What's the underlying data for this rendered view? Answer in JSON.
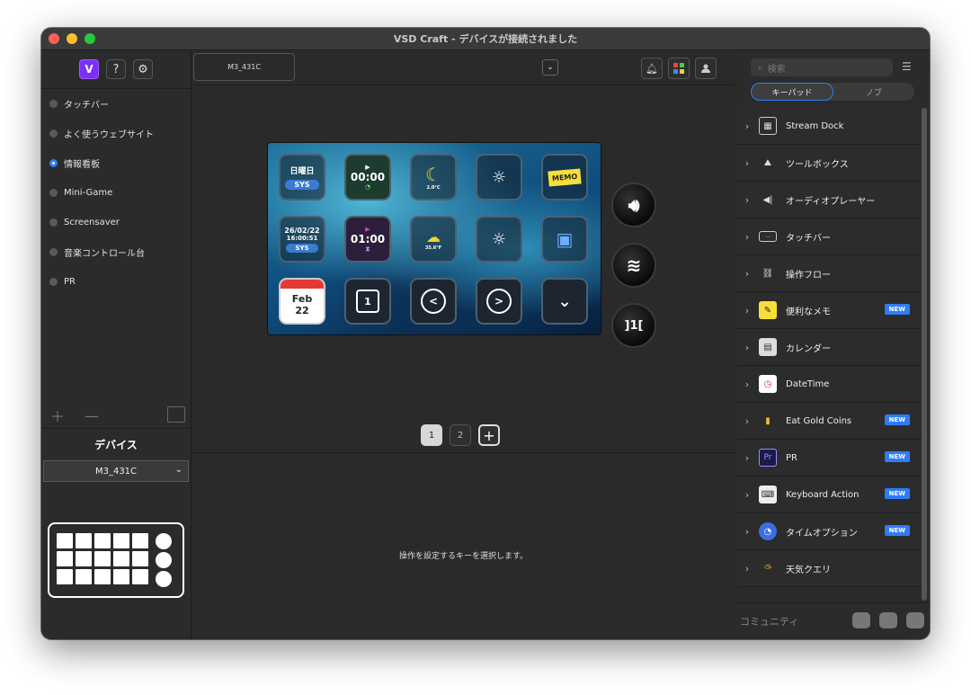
{
  "window": {
    "title": "VSD Craft - デバイスが接続されました"
  },
  "left": {
    "pages": [
      {
        "label": "タッチバー",
        "selected": false
      },
      {
        "label": "よく使うウェブサイト",
        "selected": false
      },
      {
        "label": "情報看板",
        "selected": true
      },
      {
        "label": "Mini-Game",
        "selected": false
      },
      {
        "label": "Screensaver",
        "selected": false
      },
      {
        "label": "音楽コントロール台",
        "selected": false
      },
      {
        "label": "PR",
        "selected": false
      }
    ],
    "device_title": "デバイス",
    "device_select": "M3_431C"
  },
  "center": {
    "device_tab": "M3_431C",
    "keys": {
      "k1_line1": "日曜日",
      "k1_line2": "SYS",
      "k2_line1": "00:00",
      "k3_line1": "2.0°C",
      "k5_line1": "MEMO",
      "k6_line1": "26/02/22",
      "k6_line2": "16:00:51",
      "k6_line3": "SYS",
      "k7_line1": "01:00",
      "k8_line1": "35.6°F",
      "k11_line1": "Feb",
      "k11_line2": "22",
      "k12_line1": "1",
      "k13_line1": "<",
      "k14_line1": ">"
    },
    "pages": [
      "1",
      "2"
    ],
    "hint": "操作を設定するキーを選択します。"
  },
  "right": {
    "search_placeholder": "検索",
    "tabs": [
      "キーパッド",
      "ノブ"
    ],
    "plugins": [
      {
        "label": "Stream Dock",
        "new": false,
        "icon": "grid-icon"
      },
      {
        "label": "ツールボックス",
        "new": false,
        "icon": "toolbox-icon"
      },
      {
        "label": "オーディオプレーヤー",
        "new": false,
        "icon": "audio-icon"
      },
      {
        "label": "タッチバー",
        "new": false,
        "icon": "keyboard-icon"
      },
      {
        "label": "操作フロー",
        "new": false,
        "icon": "flow-icon"
      },
      {
        "label": "便利なメモ",
        "new": true,
        "icon": "memo-icon"
      },
      {
        "label": "カレンダー",
        "new": false,
        "icon": "calendar-icon"
      },
      {
        "label": "DateTime",
        "new": false,
        "icon": "clock-icon"
      },
      {
        "label": "Eat Gold Coins",
        "new": true,
        "icon": "coin-icon"
      },
      {
        "label": "PR",
        "new": true,
        "icon": "premiere-icon"
      },
      {
        "label": "Keyboard Action",
        "new": true,
        "icon": "keyboard-action-icon"
      },
      {
        "label": "タイムオプション",
        "new": true,
        "icon": "time-option-icon"
      },
      {
        "label": "天気クエリ",
        "new": false,
        "icon": "weather-icon"
      }
    ],
    "new_badge": "NEW",
    "community": "コミュニティ"
  },
  "colors": {
    "accent": "#2f7df6",
    "background": "#2a2a2a"
  }
}
